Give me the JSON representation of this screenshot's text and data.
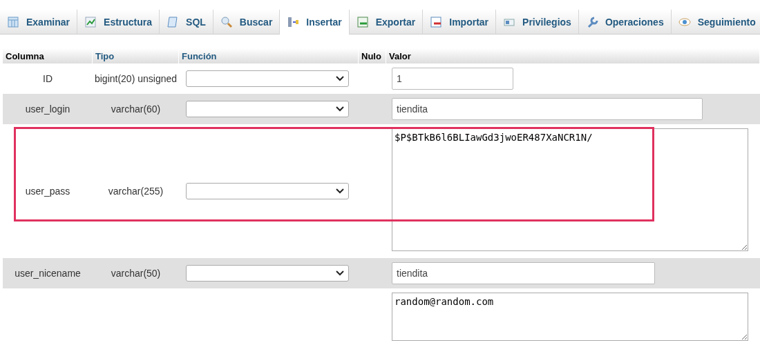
{
  "tabs": [
    {
      "label": "Examinar",
      "selected": false
    },
    {
      "label": "Estructura",
      "selected": false
    },
    {
      "label": "SQL",
      "selected": false
    },
    {
      "label": "Buscar",
      "selected": false
    },
    {
      "label": "Insertar",
      "selected": true
    },
    {
      "label": "Exportar",
      "selected": false
    },
    {
      "label": "Importar",
      "selected": false
    },
    {
      "label": "Privilegios",
      "selected": false
    },
    {
      "label": "Operaciones",
      "selected": false
    },
    {
      "label": "Seguimiento",
      "selected": false
    }
  ],
  "table": {
    "columns": [
      "Columna",
      "Tipo",
      "Función",
      "Nulo",
      "Valor"
    ],
    "rows": [
      {
        "name": "ID",
        "type": "bigint(20) unsigned",
        "value": {
          "kind": "input",
          "text": "1"
        },
        "highlighted": false
      },
      {
        "name": "user_login",
        "type": "varchar(60)",
        "value": {
          "kind": "input",
          "text": "tiendita"
        },
        "highlighted": false
      },
      {
        "name": "user_pass",
        "type": "varchar(255)",
        "value": {
          "kind": "textarea",
          "text": "$P$BTkB6l6BLIawGd3jwoER487XaNCR1N/"
        },
        "highlighted": true
      },
      {
        "name": "user_nicename",
        "type": "varchar(50)",
        "value": {
          "kind": "input",
          "text": "tiendita"
        },
        "highlighted": false
      },
      {
        "value": {
          "kind": "textarea",
          "text": "random@random.com"
        },
        "highlighted": false
      }
    ]
  }
}
